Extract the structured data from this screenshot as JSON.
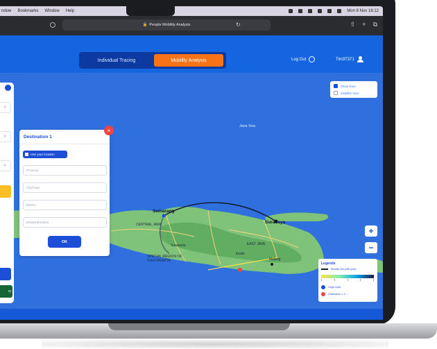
{
  "menubar": {
    "items": [
      "ndow",
      "Bookmarks",
      "Window",
      "Help"
    ],
    "clock": "Mon 8 Nov 16:12"
  },
  "browser": {
    "url": "People Mobility Analysis"
  },
  "nav": {
    "tabs": [
      {
        "label": "Individual Tracing",
        "active": false
      },
      {
        "label": "Mobility Analysis",
        "active": true
      }
    ],
    "logout_label": "Log Out",
    "username": "Tim3T371"
  },
  "map": {
    "sea_label": "Java Sea",
    "cities": {
      "semarang": "Semarang",
      "surabaya": "Surabaya",
      "central_java": "CENTRAL JAVA",
      "east_java": "EAST JAVA",
      "kediri": "Kediri",
      "malang": "Malang",
      "yogyakarta": "SPECIAL REGION OF YOGYAKARTA",
      "surakarta": "Surakarta"
    }
  },
  "toggles": {
    "show_route": "Show lines",
    "satellite": "Satellite view"
  },
  "dialog": {
    "title": "Destination 1",
    "use_location": "Use your location",
    "province_placeholder": "Province",
    "city_placeholder": "City/Town",
    "district_placeholder": "District",
    "village_placeholder": "Desa/Kelurahan",
    "ok_label": "OK",
    "close_symbol": "×"
  },
  "left_panel": {
    "green_label": "ry"
  },
  "zoom": {
    "in": "+",
    "out": "−"
  },
  "legend": {
    "title": "Legends",
    "route_label": "Mobility line (with year)",
    "origin_label": "Origin point",
    "destination_label": "Destination 1, 2, ...",
    "origin_color": "#1d4ed8",
    "destination_color": "#ef4444"
  },
  "colors": {
    "accent": "#1565e0",
    "active_tab": "#f97316",
    "sea": "#2f6fde"
  }
}
